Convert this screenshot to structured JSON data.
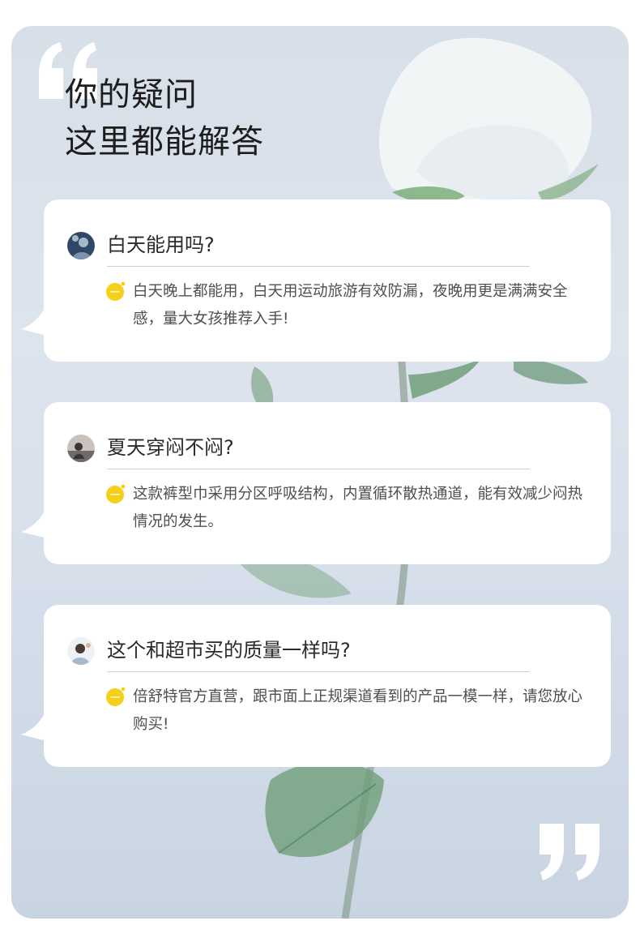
{
  "headline": {
    "line1": "你的疑问",
    "line2": "这里都能解答"
  },
  "colors": {
    "panel_bg": "#d7dfe9",
    "card_bg": "#ffffff",
    "badge_yellow": "#f5cf18",
    "headline_text": "#1d1d1d",
    "answer_text": "#4f4f4f"
  },
  "faq": [
    {
      "avatar": "user-avatar-1",
      "question": "白天能用吗?",
      "answer": "白天晚上都能用，白天用运动旅游有效防漏，夜晚用更是满满安全感，量大女孩推荐入手!"
    },
    {
      "avatar": "user-avatar-2",
      "question": "夏天穿闷不闷?",
      "answer": "这款裤型巾采用分区呼吸结构，内置循环散热通道，能有效减少闷热情况的发生。"
    },
    {
      "avatar": "user-avatar-3",
      "question": "这个和超市买的质量一样吗?",
      "answer": "倍舒特官方直营，跟市面上正规渠道看到的产品一模一样，请您放心购买!"
    }
  ]
}
